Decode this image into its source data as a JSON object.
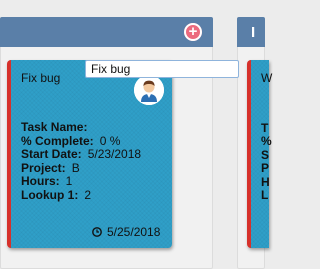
{
  "column2": {
    "header_title": "I"
  },
  "card1": {
    "title": "Fix bug",
    "avatar_icon": "person-avatar-icon",
    "fields": {
      "task_name_label": "Task Name:",
      "task_name_value": "Fix bug",
      "percent_label": "% Complete:",
      "percent_value": "0 %",
      "start_label": "Start Date:",
      "start_value": "5/23/2018",
      "project_label": "Project:",
      "project_value": "B",
      "hours_label": "Hours:",
      "hours_value": "1",
      "lookup_label": "Lookup 1:",
      "lookup_value": "2"
    },
    "due_date": "5/25/2018",
    "due_icon": "clock-icon"
  },
  "card2": {
    "title_partial": "W",
    "peek_letters": [
      "T",
      "%",
      "S",
      "P",
      "H",
      "L"
    ]
  },
  "colors": {
    "header": "#5a7fa8",
    "card": "#2f9fc8",
    "card_border": "#d6312b",
    "add_button": "#ec6a7e"
  }
}
